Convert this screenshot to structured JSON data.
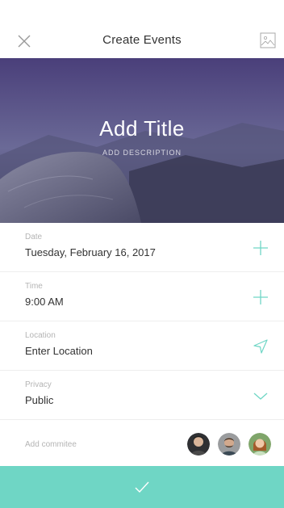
{
  "header": {
    "title": "Create Events",
    "close_icon": "close-icon",
    "image_icon": "image-icon"
  },
  "hero": {
    "title": "Add Title",
    "description": "ADD DESCRIPTION"
  },
  "fields": {
    "date": {
      "label": "Date",
      "value": "Tuesday, February 16, 2017",
      "action_icon": "plus-icon"
    },
    "time": {
      "label": "Time",
      "value": "9:00 AM",
      "action_icon": "plus-icon"
    },
    "location": {
      "label": "Location",
      "value": "Enter Location",
      "action_icon": "navigation-arrow-icon"
    },
    "privacy": {
      "label": "Privacy",
      "value": "Public",
      "action_icon": "chevron-down-icon"
    }
  },
  "committee": {
    "label": "Add commitee",
    "members": [
      "avatar-1",
      "avatar-2",
      "avatar-3"
    ]
  },
  "submit": {
    "icon": "check-icon"
  },
  "colors": {
    "accent": "#6fd6c5",
    "label": "#b4b4b4",
    "text": "#333333"
  }
}
